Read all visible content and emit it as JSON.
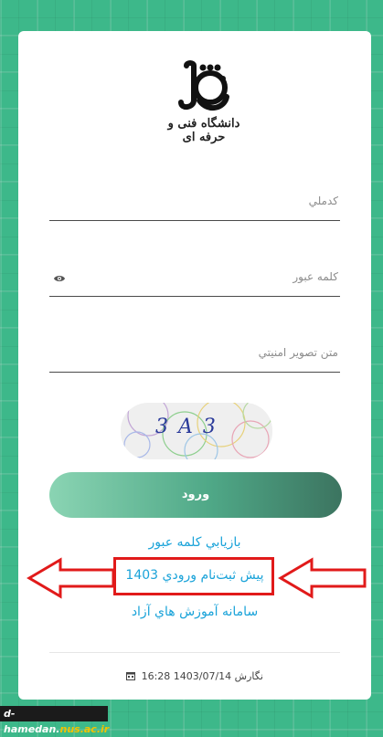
{
  "university_name": "دانشگاه فنی و حرفه ای",
  "form": {
    "national_code_placeholder": "کدملي",
    "password_placeholder": "کلمه عبور",
    "captcha_placeholder": "متن تصوير امنيتي",
    "captcha_text": "3 A 3",
    "login_button": "ورود"
  },
  "links": {
    "recover_password": "بازيابي کلمه عبور",
    "pre_registration": "پيش ثبت‌نام ورودي 1403",
    "free_courses": "سامانه آموزش هاي آزاد"
  },
  "footer": {
    "version_text": "نگارش 1403/07/14 16:28"
  },
  "watermark": {
    "prefix": "d-hamedan.",
    "domain": "nus.ac.ir"
  },
  "colors": {
    "background": "#3db88a",
    "link": "#1aa3d9",
    "highlight": "#e11a1a"
  }
}
